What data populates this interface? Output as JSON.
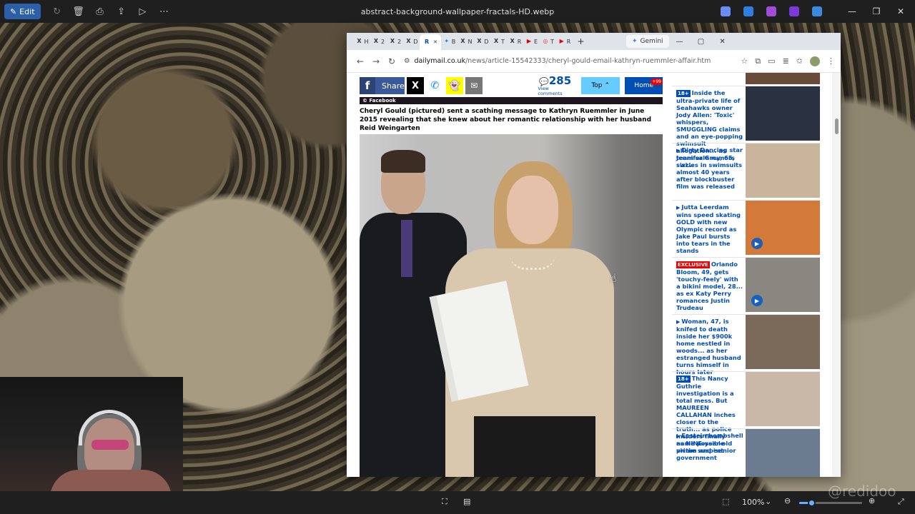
{
  "viewer": {
    "edit_label": "Edit",
    "file_title": "abstract-background-wallpaper-fractals-HD.webp",
    "zoom_level": "100%",
    "watermark": "@redidoo"
  },
  "browser": {
    "tabs": [
      {
        "icon": "x-icon",
        "glyph": "X",
        "label": "H"
      },
      {
        "icon": "x-icon",
        "glyph": "X",
        "label": "2"
      },
      {
        "icon": "x-icon",
        "glyph": "X",
        "label": "2"
      },
      {
        "icon": "x-icon",
        "glyph": "X",
        "label": "D"
      },
      {
        "icon": "dailymail-icon",
        "glyph": "R",
        "label": "",
        "active": true
      },
      {
        "icon": "bluesky-icon",
        "glyph": "✦",
        "label": "B"
      },
      {
        "icon": "x-icon",
        "glyph": "X",
        "label": "N"
      },
      {
        "icon": "x-icon",
        "glyph": "X",
        "label": "D"
      },
      {
        "icon": "x-icon",
        "glyph": "X",
        "label": "T"
      },
      {
        "icon": "x-icon",
        "glyph": "X",
        "label": "R"
      },
      {
        "icon": "youtube-icon",
        "glyph": "▶",
        "label": "E"
      },
      {
        "icon": "pocketcasts-icon",
        "glyph": "◎",
        "label": "T"
      },
      {
        "icon": "youtube-icon",
        "glyph": "▶",
        "label": "R"
      }
    ],
    "gemini_label": "Gemini",
    "url_host": "dailymail.co.uk",
    "url_path": "/news/article-15542333/cheryl-gould-email-kathryn-ruemmler-affair.html?ns_mc..."
  },
  "sharebar": {
    "share_label": "Share",
    "comment_count": "285",
    "view_comments": "View comments",
    "top_label": "Top",
    "home_label": "Home",
    "home_badge": "+99"
  },
  "article": {
    "photo_credit": "© Facebook",
    "caption": "Cheryl Gould (pictured) sent a scathing message to Kathryn Ruemmler in June 2015 revealing that she knew about her romantic relationship with her husband Reid Weingarten"
  },
  "sidebar": {
    "items": [
      {
        "tag": "18+",
        "tag_type": "plus",
        "text": "Inside the ultra-private life of Seahawks owner Jody Allen: 'Toxic' whispers, SMUGGLING claims and an eye-popping swimsuit allegation... as team sale rumors swi...",
        "thumb_color": "#2a3140",
        "video": false
      },
      {
        "tag": "",
        "tag_type": "",
        "text": "Dirty Dancing star Jennifer Grey, 65, sizzles in swimsuits almost 40 years after blockbuster film was released",
        "thumb_color": "#c8b59b",
        "video": false
      },
      {
        "tag": "",
        "tag_type": "",
        "text": "Jutta Leerdam wins speed skating GOLD with new Olympic record as Jake Paul bursts into tears in the stands",
        "thumb_color": "#d37a3a",
        "video": true
      },
      {
        "tag": "EXCLUSIVE",
        "tag_type": "excl",
        "text": "Orlando Bloom, 49, gets 'touchy-feely' with a bikini model, 28... as ex Katy Perry romances Justin Trudeau",
        "thumb_color": "#8a8680",
        "video": true
      },
      {
        "tag": "",
        "tag_type": "",
        "text": "Woman, 47, is knifed to death inside her $900k home nestled in woods... as her estranged husband turns himself in hours later",
        "thumb_color": "#7b6a5a",
        "video": false
      },
      {
        "tag": "18+",
        "tag_type": "plus",
        "text": "This Nancy Guthrie investigation is a total mess. But MAUREEN CALLAHAN inches closer to the truth... as police insiders finally name possible prime suspect",
        "thumb_color": "#c9b7a8",
        "video": false
      },
      {
        "tag": "",
        "tag_type": "",
        "text": "Epstein bombshell as NINE-year-old victim and 'senior government",
        "thumb_color": "#6c7c90",
        "video": false
      }
    ]
  }
}
